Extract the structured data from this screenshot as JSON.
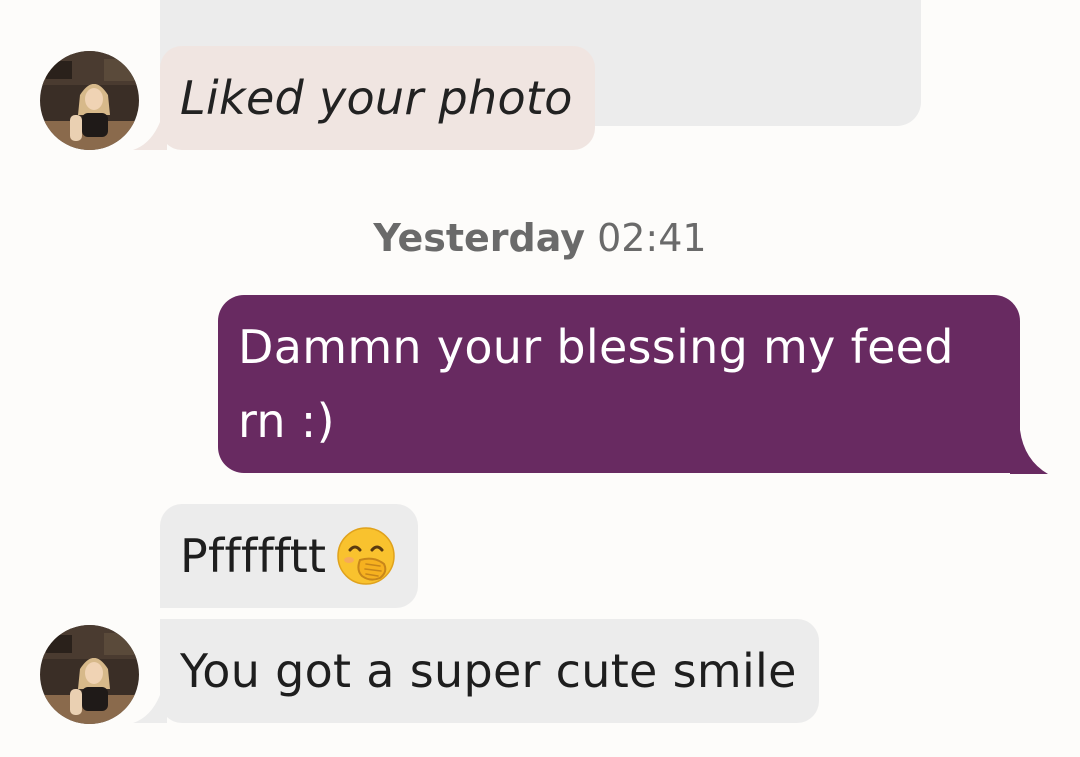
{
  "conversation": {
    "messages": [
      {
        "sender": "them",
        "type": "reaction",
        "text": "Liked your photo"
      },
      {
        "sender": "me",
        "type": "text",
        "text": "Dammn your blessing my feed rn :)"
      },
      {
        "sender": "them",
        "type": "text",
        "text": "Pffffftt",
        "emoji": "face-with-hand-over-mouth"
      },
      {
        "sender": "them",
        "type": "text",
        "text": "You got a super cute smile"
      }
    ],
    "timestamp": {
      "day": "Yesterday",
      "time": "02:41"
    }
  },
  "colors": {
    "sent_bubble": "#682a61",
    "received_bubble": "#ececec",
    "reaction_bubble": "#f0e5e1",
    "background": "#fdfcfa",
    "timestamp_text": "#6a6a6a"
  }
}
